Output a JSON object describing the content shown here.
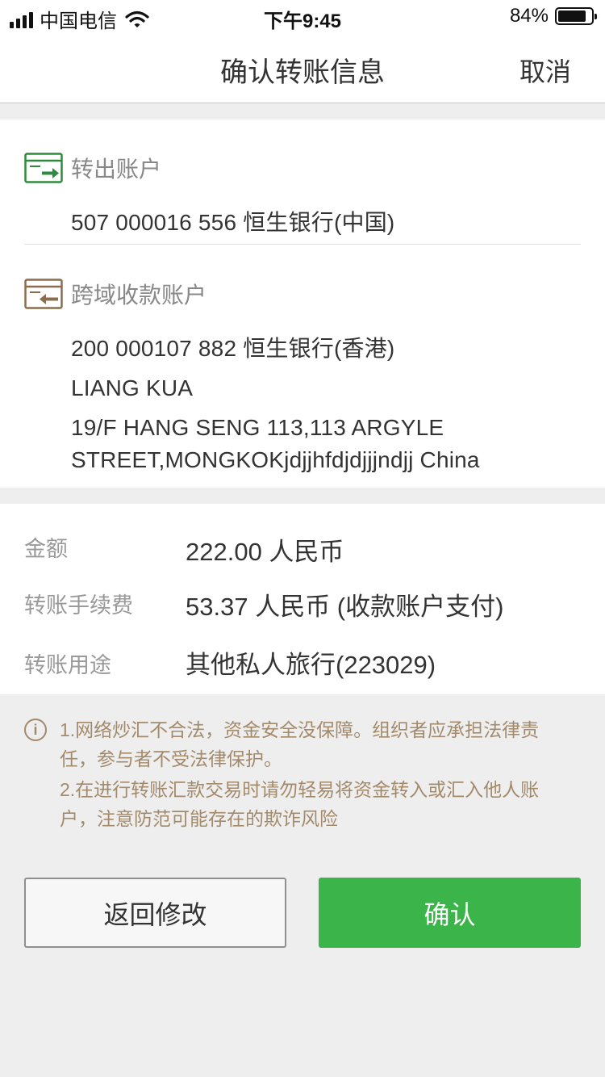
{
  "status_bar": {
    "carrier": "中国电信",
    "time": "下午9:45",
    "battery_percent": "84%",
    "battery_level": 0.84
  },
  "nav": {
    "title": "确认转账信息",
    "cancel_label": "取消"
  },
  "from_account": {
    "label": "转出账户",
    "account": "507 000016 556 恒生银行(中国)"
  },
  "to_account": {
    "label": "跨域收款账户",
    "account": "200 000107 882 恒生银行(香港)",
    "name": "LIANG KUA",
    "address_line1": "19/F HANG SENG 113,113 ARGYLE",
    "address_line2": "STREET,MONGKOKjdjjhfdjdjjjndjj China"
  },
  "details": {
    "amount_label": "金额",
    "amount_value": "222.00 人民币",
    "fee_label": "转账手续费",
    "fee_value": "53.37 人民币 (收款账户支付)",
    "purpose_label": "转账用途",
    "purpose_value": "其他私人旅行(223029)"
  },
  "notice": {
    "icon": "info-icon",
    "line1": "1.网络炒汇不合法，资金安全没保障。组织者应承担法律责",
    "line2": "任，参与者不受法律保护。",
    "line3": "2.在进行转账汇款交易时请勿轻易将资金转入或汇入他人账",
    "line4": "户，注意防范可能存在的欺诈风险"
  },
  "buttons": {
    "back_label": "返回修改",
    "confirm_label": "确认"
  },
  "colors": {
    "brand_green": "#3bb54a",
    "notice_brown": "#a38a6a",
    "from_icon_green": "#2e8b3d",
    "to_icon_brown": "#8b6e4e"
  }
}
